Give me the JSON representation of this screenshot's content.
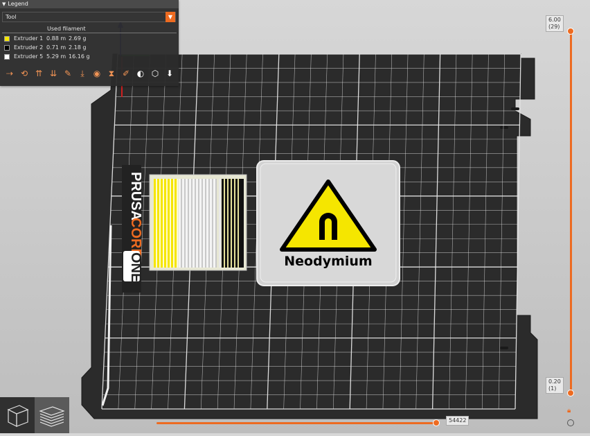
{
  "legend": {
    "title": "Legend",
    "view_type": "Tool",
    "header": "Used filament",
    "rows": [
      {
        "name": "Extruder 1",
        "length": "0.88 m",
        "weight": "2.69 g",
        "color": "#f5e600"
      },
      {
        "name": "Extruder 2",
        "length": "0.71 m",
        "weight": "2.18 g",
        "color": "#000000"
      },
      {
        "name": "Extruder 5",
        "length": "5.29 m",
        "weight": "16.16 g",
        "color": "#ffffff"
      }
    ],
    "options": [
      "travel-icon",
      "wipe-icon",
      "retractions-icon",
      "deretractions-icon",
      "seams-icon",
      "tool-changes-icon",
      "color-changes-icon",
      "pause-prints-icon",
      "custom-gcodes-icon",
      "center-of-gravity-icon",
      "shells-icon",
      "tool-marker-icon"
    ]
  },
  "bed": {
    "brand_1": "PRUSA",
    "brand_2": "CORE",
    "brand_3": "ONE",
    "object_label": "Neodymium"
  },
  "vertical_slider": {
    "top_value": "6.00",
    "top_layer": "(29)",
    "bottom_value": "0.20",
    "bottom_layer": "(1)"
  },
  "horizontal_slider": {
    "value": "54422"
  },
  "view_buttons": [
    "3d-view-icon",
    "preview-layers-icon"
  ],
  "colors": {
    "accent": "#ed6b21",
    "bed": "#2a2a2a",
    "grid": "#e8e8e8",
    "panel": "#2c2c2c"
  }
}
